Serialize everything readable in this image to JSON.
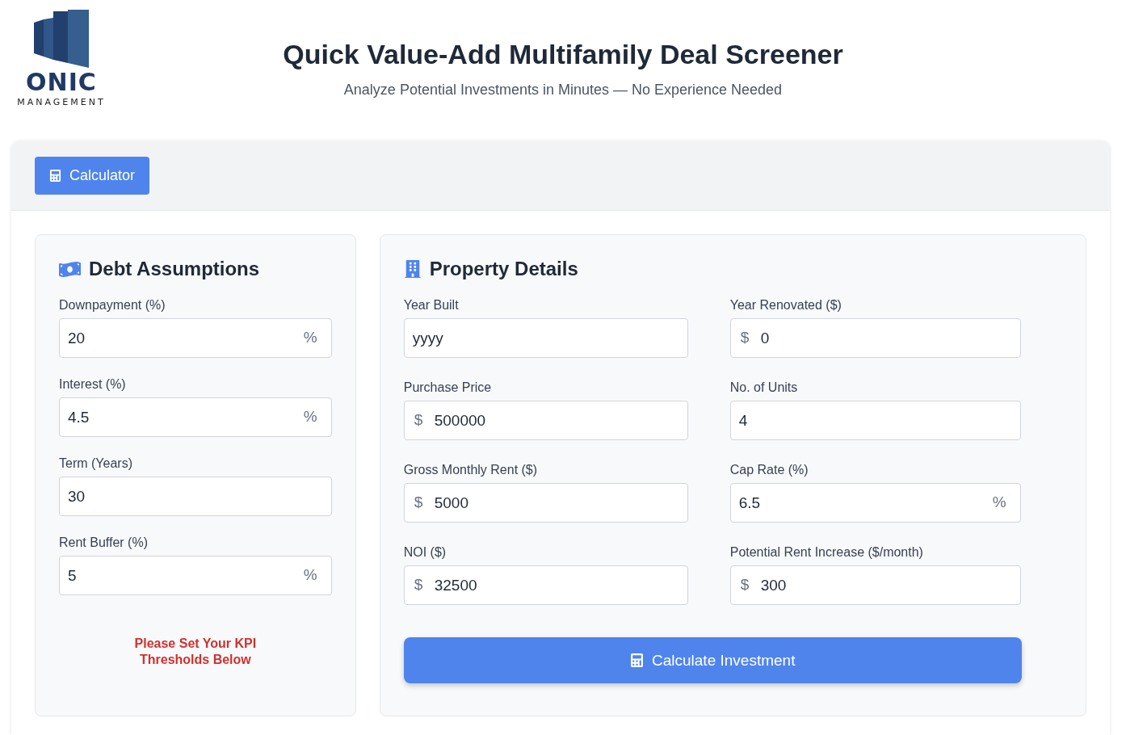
{
  "logo": {
    "name": "ONIC",
    "tagline": "MANAGEMENT"
  },
  "header": {
    "title": "Quick Value-Add Multifamily Deal Screener",
    "subtitle": "Analyze Potential Investments in Minutes — No Experience Needed"
  },
  "tabs": [
    {
      "label": "Calculator",
      "selected": true
    }
  ],
  "debt_assumptions": {
    "title": "Debt Assumptions",
    "fields": [
      {
        "label": "Downpayment (%)",
        "value": "20",
        "suffix": "%"
      },
      {
        "label": "Interest (%)",
        "value": "4.5",
        "suffix": "%"
      },
      {
        "label": "Term (Years)",
        "value": "30"
      },
      {
        "label": "Rent Buffer (%)",
        "value": "5",
        "suffix": "%"
      }
    ],
    "warning": "Please Set Your KPI Thresholds Below"
  },
  "property_details": {
    "title": "Property Details",
    "fields": [
      {
        "label": "Year Built",
        "value": "yyyy"
      },
      {
        "label": "Year Renovated ($)",
        "value": "0",
        "prefix": "$"
      },
      {
        "label": "Purchase Price",
        "value": "500000",
        "prefix": "$"
      },
      {
        "label": "No. of Units",
        "value": "4"
      },
      {
        "label": "Gross Monthly Rent ($)",
        "value": "5000",
        "prefix": "$"
      },
      {
        "label": "Cap Rate (%)",
        "value": "6.5",
        "suffix": "%"
      },
      {
        "label": "NOI ($)",
        "value": "32500",
        "prefix": "$"
      },
      {
        "label": "Potential Rent Increase ($/month)",
        "value": "300",
        "prefix": "$"
      }
    ],
    "button": "Calculate Investment"
  }
}
